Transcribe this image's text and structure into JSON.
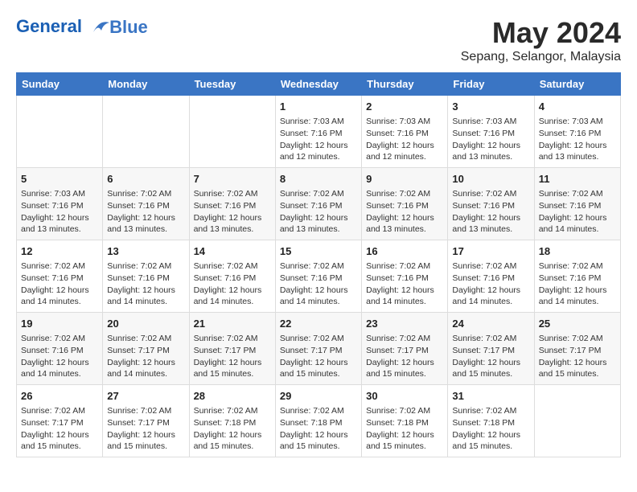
{
  "header": {
    "logo_line1": "General",
    "logo_line2": "Blue",
    "month_title": "May 2024",
    "location": "Sepang, Selangor, Malaysia"
  },
  "weekdays": [
    "Sunday",
    "Monday",
    "Tuesday",
    "Wednesday",
    "Thursday",
    "Friday",
    "Saturday"
  ],
  "weeks": [
    [
      {
        "day": "",
        "info": ""
      },
      {
        "day": "",
        "info": ""
      },
      {
        "day": "",
        "info": ""
      },
      {
        "day": "1",
        "info": "Sunrise: 7:03 AM\nSunset: 7:16 PM\nDaylight: 12 hours\nand 12 minutes."
      },
      {
        "day": "2",
        "info": "Sunrise: 7:03 AM\nSunset: 7:16 PM\nDaylight: 12 hours\nand 12 minutes."
      },
      {
        "day": "3",
        "info": "Sunrise: 7:03 AM\nSunset: 7:16 PM\nDaylight: 12 hours\nand 13 minutes."
      },
      {
        "day": "4",
        "info": "Sunrise: 7:03 AM\nSunset: 7:16 PM\nDaylight: 12 hours\nand 13 minutes."
      }
    ],
    [
      {
        "day": "5",
        "info": "Sunrise: 7:03 AM\nSunset: 7:16 PM\nDaylight: 12 hours\nand 13 minutes."
      },
      {
        "day": "6",
        "info": "Sunrise: 7:02 AM\nSunset: 7:16 PM\nDaylight: 12 hours\nand 13 minutes."
      },
      {
        "day": "7",
        "info": "Sunrise: 7:02 AM\nSunset: 7:16 PM\nDaylight: 12 hours\nand 13 minutes."
      },
      {
        "day": "8",
        "info": "Sunrise: 7:02 AM\nSunset: 7:16 PM\nDaylight: 12 hours\nand 13 minutes."
      },
      {
        "day": "9",
        "info": "Sunrise: 7:02 AM\nSunset: 7:16 PM\nDaylight: 12 hours\nand 13 minutes."
      },
      {
        "day": "10",
        "info": "Sunrise: 7:02 AM\nSunset: 7:16 PM\nDaylight: 12 hours\nand 13 minutes."
      },
      {
        "day": "11",
        "info": "Sunrise: 7:02 AM\nSunset: 7:16 PM\nDaylight: 12 hours\nand 14 minutes."
      }
    ],
    [
      {
        "day": "12",
        "info": "Sunrise: 7:02 AM\nSunset: 7:16 PM\nDaylight: 12 hours\nand 14 minutes."
      },
      {
        "day": "13",
        "info": "Sunrise: 7:02 AM\nSunset: 7:16 PM\nDaylight: 12 hours\nand 14 minutes."
      },
      {
        "day": "14",
        "info": "Sunrise: 7:02 AM\nSunset: 7:16 PM\nDaylight: 12 hours\nand 14 minutes."
      },
      {
        "day": "15",
        "info": "Sunrise: 7:02 AM\nSunset: 7:16 PM\nDaylight: 12 hours\nand 14 minutes."
      },
      {
        "day": "16",
        "info": "Sunrise: 7:02 AM\nSunset: 7:16 PM\nDaylight: 12 hours\nand 14 minutes."
      },
      {
        "day": "17",
        "info": "Sunrise: 7:02 AM\nSunset: 7:16 PM\nDaylight: 12 hours\nand 14 minutes."
      },
      {
        "day": "18",
        "info": "Sunrise: 7:02 AM\nSunset: 7:16 PM\nDaylight: 12 hours\nand 14 minutes."
      }
    ],
    [
      {
        "day": "19",
        "info": "Sunrise: 7:02 AM\nSunset: 7:16 PM\nDaylight: 12 hours\nand 14 minutes."
      },
      {
        "day": "20",
        "info": "Sunrise: 7:02 AM\nSunset: 7:17 PM\nDaylight: 12 hours\nand 14 minutes."
      },
      {
        "day": "21",
        "info": "Sunrise: 7:02 AM\nSunset: 7:17 PM\nDaylight: 12 hours\nand 15 minutes."
      },
      {
        "day": "22",
        "info": "Sunrise: 7:02 AM\nSunset: 7:17 PM\nDaylight: 12 hours\nand 15 minutes."
      },
      {
        "day": "23",
        "info": "Sunrise: 7:02 AM\nSunset: 7:17 PM\nDaylight: 12 hours\nand 15 minutes."
      },
      {
        "day": "24",
        "info": "Sunrise: 7:02 AM\nSunset: 7:17 PM\nDaylight: 12 hours\nand 15 minutes."
      },
      {
        "day": "25",
        "info": "Sunrise: 7:02 AM\nSunset: 7:17 PM\nDaylight: 12 hours\nand 15 minutes."
      }
    ],
    [
      {
        "day": "26",
        "info": "Sunrise: 7:02 AM\nSunset: 7:17 PM\nDaylight: 12 hours\nand 15 minutes."
      },
      {
        "day": "27",
        "info": "Sunrise: 7:02 AM\nSunset: 7:17 PM\nDaylight: 12 hours\nand 15 minutes."
      },
      {
        "day": "28",
        "info": "Sunrise: 7:02 AM\nSunset: 7:18 PM\nDaylight: 12 hours\nand 15 minutes."
      },
      {
        "day": "29",
        "info": "Sunrise: 7:02 AM\nSunset: 7:18 PM\nDaylight: 12 hours\nand 15 minutes."
      },
      {
        "day": "30",
        "info": "Sunrise: 7:02 AM\nSunset: 7:18 PM\nDaylight: 12 hours\nand 15 minutes."
      },
      {
        "day": "31",
        "info": "Sunrise: 7:02 AM\nSunset: 7:18 PM\nDaylight: 12 hours\nand 15 minutes."
      },
      {
        "day": "",
        "info": ""
      }
    ]
  ]
}
